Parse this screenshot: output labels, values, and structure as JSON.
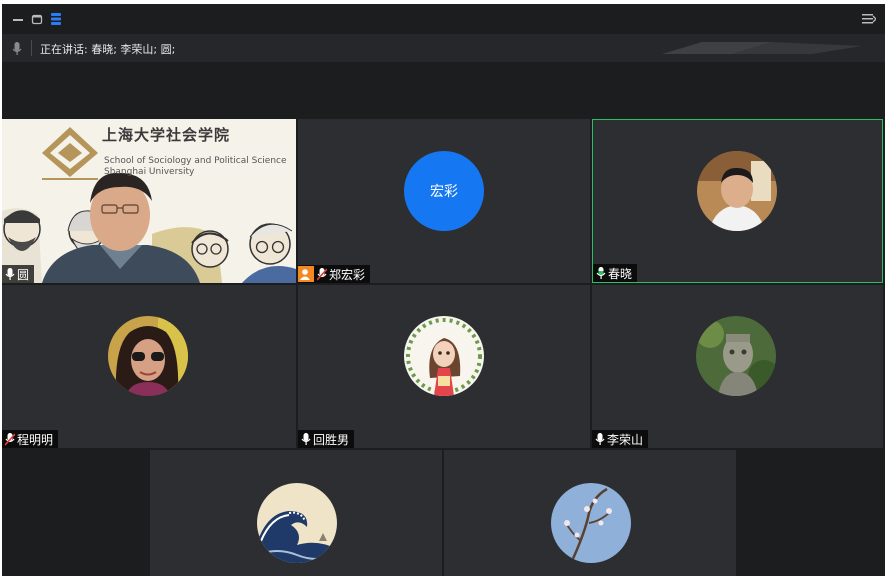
{
  "window": {
    "speaker_label": "正在讲话: 春晓; 李荣山; 圆;"
  },
  "participants": [
    {
      "name": "圆",
      "mic": "on",
      "video": true,
      "video_text": {
        "cn": "上海大学社会学院",
        "en_line1": "School of Sociology and Political Science",
        "en_line2": "Shanghai University"
      }
    },
    {
      "name": "郑宏彩",
      "mic": "muted",
      "host": true,
      "avatar_text": "宏彩",
      "avatar_color": "#1677f2"
    },
    {
      "name": "春晓",
      "mic": "speaking",
      "active": true
    },
    {
      "name": "程明明",
      "mic": "muted"
    },
    {
      "name": "回胜男",
      "mic": "on"
    },
    {
      "name": "李荣山",
      "mic": "on"
    },
    {
      "name": "",
      "avatar_art": "great-wave"
    },
    {
      "name": "",
      "avatar_art": "blossom-branch"
    }
  ],
  "colors": {
    "active_border": "#2dbd63",
    "accent": "#1677f2",
    "host": "#f28a21",
    "muted": "#e0413a"
  }
}
